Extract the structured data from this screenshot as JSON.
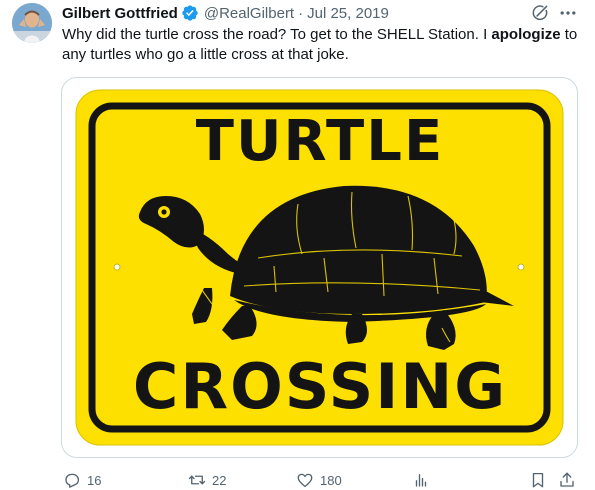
{
  "author": {
    "name": "Gilbert Gottfried",
    "handle": "@RealGilbert",
    "separator": "·",
    "date": "Jul 25, 2019"
  },
  "tweet": {
    "text_before": "Why did the turtle cross the road?  To get to the SHELL Station.  I ",
    "text_bold": "apologize",
    "text_after": " to any turtles who go a little cross at that joke."
  },
  "media": {
    "sign_line_1": "TURTLE",
    "sign_line_2": "CROSSING",
    "colors": {
      "sign_yellow": "#fde000",
      "sign_black": "#141414"
    }
  },
  "actions": {
    "replies": "16",
    "retweets": "22",
    "likes": "180",
    "views": ""
  },
  "icons": {
    "verified": "verified-badge-icon",
    "grok": "grok-icon",
    "more": "more-icon",
    "reply": "reply-icon",
    "retweet": "retweet-icon",
    "like": "heart-icon",
    "views": "analytics-icon",
    "bookmark": "bookmark-icon",
    "share": "share-icon"
  },
  "colors": {
    "text_primary": "#0f1419",
    "text_secondary": "#536471",
    "verified_blue": "#1d9bf0",
    "border": "#cfd9de"
  }
}
